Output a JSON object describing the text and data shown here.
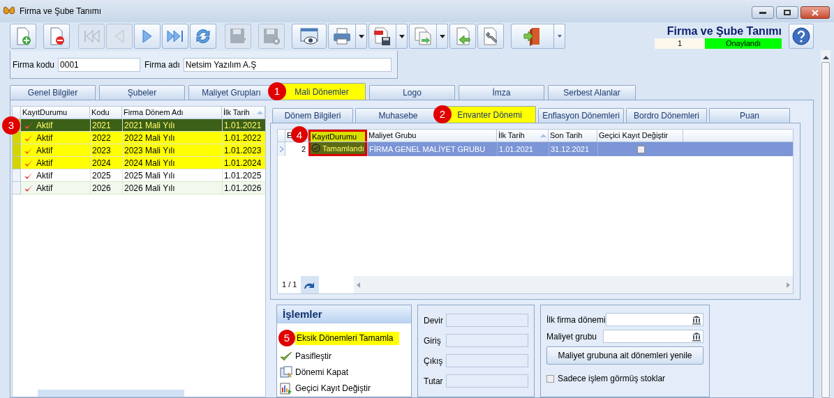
{
  "window": {
    "title": "Firma ve Şube Tanımı"
  },
  "toolbar": [
    {
      "kind": "new",
      "disabled": false
    },
    {
      "kind": "delete",
      "disabled": false
    },
    {
      "kind": "first",
      "disabled": true
    },
    {
      "kind": "prev",
      "disabled": true
    },
    {
      "kind": "next",
      "disabled": false
    },
    {
      "kind": "last",
      "disabled": false
    },
    {
      "kind": "refresh",
      "disabled": false
    },
    {
      "kind": "save",
      "disabled": true
    },
    {
      "kind": "cancel",
      "disabled": true
    },
    {
      "kind": "preview",
      "disabled": false
    },
    {
      "kind": "print",
      "disabled": false
    },
    {
      "kind": "pdf",
      "disabled": false
    },
    {
      "kind": "export",
      "disabled": false
    },
    {
      "kind": "import",
      "disabled": false
    },
    {
      "kind": "tools",
      "disabled": false
    },
    {
      "kind": "exit",
      "disabled": false
    }
  ],
  "header": {
    "title": "Firma ve Şube Tanımı",
    "record": "1",
    "status": "Onaylandı"
  },
  "firm_fields": [
    {
      "label": "Firma kodu",
      "value": "0001"
    },
    {
      "label": "Firma adı",
      "value": "Netsim Yazılım A.Ş"
    }
  ],
  "main_tabs": [
    {
      "label": "Genel Bilgiler",
      "selected": false,
      "highlighted": false
    },
    {
      "label": "Şubeler",
      "selected": false,
      "highlighted": false
    },
    {
      "label": "Maliyet Grupları",
      "selected": false,
      "highlighted": false
    },
    {
      "label": "Mali Dönemler",
      "selected": true,
      "highlighted": true,
      "callout": "1"
    },
    {
      "label": "Logo",
      "selected": false,
      "highlighted": false
    },
    {
      "label": "İmza",
      "selected": false,
      "highlighted": false
    },
    {
      "label": "Serbest Alanlar",
      "selected": false,
      "highlighted": false
    }
  ],
  "periods": {
    "callout": "3",
    "columns": [
      "KayıtDurumu",
      "Kodu",
      "Firma Dönem Adı",
      "İlk Tarih"
    ],
    "rows": [
      {
        "status": "Aktif",
        "code": "2021",
        "name": "2021 Mali Yılı",
        "start": "1.01.2021",
        "highlighted": true,
        "selected": true
      },
      {
        "status": "Aktif",
        "code": "2022",
        "name": "2022 Mali Yılı",
        "start": "1.01.2022",
        "highlighted": true,
        "selected": false
      },
      {
        "status": "Aktif",
        "code": "2023",
        "name": "2023 Mali Yılı",
        "start": "1.01.2023",
        "highlighted": true,
        "selected": false
      },
      {
        "status": "Aktif",
        "code": "2024",
        "name": "2024 Mali Yılı",
        "start": "1.01.2024",
        "highlighted": true,
        "selected": false
      },
      {
        "status": "Aktif",
        "code": "2025",
        "name": "2025 Mali Yılı",
        "start": "1.01.2025",
        "highlighted": false,
        "selected": false
      },
      {
        "status": "Aktif",
        "code": "2026",
        "name": "2026 Mali Yılı",
        "start": "1.01.2026",
        "highlighted": false,
        "selected": false
      }
    ]
  },
  "sub_tabs": [
    {
      "label": "Dönem Bilgileri",
      "selected": false,
      "highlighted": false
    },
    {
      "label": "Muhasebe",
      "selected": false,
      "highlighted": false
    },
    {
      "label": "Envanter Dönemi",
      "selected": true,
      "highlighted": true,
      "callout": "2"
    },
    {
      "label": "Enflasyon Dönemleri",
      "selected": false,
      "highlighted": false
    },
    {
      "label": "Bordro Dönemleri",
      "selected": false,
      "highlighted": false
    },
    {
      "label": "Puan",
      "selected": false,
      "highlighted": false
    }
  ],
  "inventory": {
    "callout": "4",
    "columns": [
      "E",
      "KayıtDurumu",
      "Maliyet Grubu",
      "İlk Tarih",
      "Son Tarih",
      "Geçici Kayıt Değiştir"
    ],
    "rows": [
      {
        "column_1": "2",
        "status": "Tamamlandı",
        "group": "FİRMA GENEL MALİYET GRUBU",
        "start": "1.01.2021",
        "end": "31.12.2021",
        "temp_change": false,
        "selected": true
      }
    ],
    "pager": "1 / 1"
  },
  "operations": {
    "title": "İşlemler",
    "items": [
      {
        "label": "Eksik Dönemleri Tamamla",
        "kind": "complete",
        "highlighted": true,
        "callout": "5"
      },
      {
        "label": "Pasifleştir",
        "kind": "check",
        "highlighted": false
      },
      {
        "label": "Dönemi Kapat",
        "kind": "close",
        "highlighted": false
      },
      {
        "label": "Geçici Kayıt Değiştir",
        "kind": "edit",
        "highlighted": false
      }
    ]
  },
  "amounts": [
    "Devir",
    "Giriş",
    "Çıkış",
    "Tutar"
  ],
  "options": {
    "fields": [
      {
        "label": "İlk firma dönemi"
      },
      {
        "label": "Maliyet grubu"
      }
    ],
    "button": "Maliyet grubuna ait dönemleri yenile",
    "checkbox": {
      "label": "Sadece işlem görmüş stoklar",
      "checked": false
    }
  }
}
